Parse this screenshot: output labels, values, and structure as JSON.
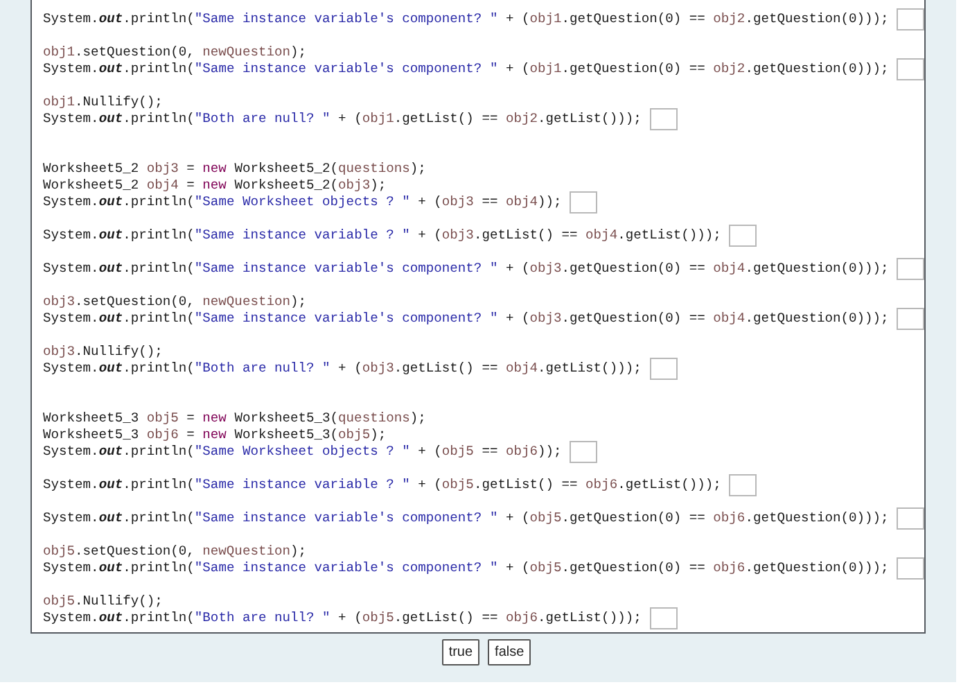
{
  "sections": [
    {
      "blocks": [
        {
          "lines": [
            {
              "has_answer": true,
              "parts": [
                {
                  "kind": "plain",
                  "text": "System."
                },
                {
                  "kind": "field",
                  "text": "out"
                },
                {
                  "kind": "plain",
                  "text": ".println("
                },
                {
                  "kind": "string",
                  "text": "\"Same instance variable's component? \""
                },
                {
                  "kind": "plain",
                  "text": " + ("
                },
                {
                  "kind": "var",
                  "text": "obj1"
                },
                {
                  "kind": "plain",
                  "text": ".getQuestion(0) == "
                },
                {
                  "kind": "var",
                  "text": "obj2"
                },
                {
                  "kind": "plain",
                  "text": ".getQuestion(0)));"
                }
              ]
            }
          ]
        },
        {
          "lines": [
            {
              "has_answer": false,
              "parts": [
                {
                  "kind": "var",
                  "text": "obj1"
                },
                {
                  "kind": "plain",
                  "text": ".setQuestion(0, "
                },
                {
                  "kind": "var",
                  "text": "newQuestion"
                },
                {
                  "kind": "plain",
                  "text": ");"
                }
              ]
            },
            {
              "has_answer": true,
              "parts": [
                {
                  "kind": "plain",
                  "text": "System."
                },
                {
                  "kind": "field",
                  "text": "out"
                },
                {
                  "kind": "plain",
                  "text": ".println("
                },
                {
                  "kind": "string",
                  "text": "\"Same instance variable's component? \""
                },
                {
                  "kind": "plain",
                  "text": " + ("
                },
                {
                  "kind": "var",
                  "text": "obj1"
                },
                {
                  "kind": "plain",
                  "text": ".getQuestion(0) == "
                },
                {
                  "kind": "var",
                  "text": "obj2"
                },
                {
                  "kind": "plain",
                  "text": ".getQuestion(0)));"
                }
              ]
            }
          ]
        },
        {
          "lines": [
            {
              "has_answer": false,
              "parts": [
                {
                  "kind": "var",
                  "text": "obj1"
                },
                {
                  "kind": "plain",
                  "text": ".Nullify();"
                }
              ]
            },
            {
              "has_answer": true,
              "parts": [
                {
                  "kind": "plain",
                  "text": "System."
                },
                {
                  "kind": "field",
                  "text": "out"
                },
                {
                  "kind": "plain",
                  "text": ".println("
                },
                {
                  "kind": "string",
                  "text": "\"Both are null? \""
                },
                {
                  "kind": "plain",
                  "text": " + ("
                },
                {
                  "kind": "var",
                  "text": "obj1"
                },
                {
                  "kind": "plain",
                  "text": ".getList() == "
                },
                {
                  "kind": "var",
                  "text": "obj2"
                },
                {
                  "kind": "plain",
                  "text": ".getList()));"
                }
              ]
            }
          ]
        }
      ]
    },
    {
      "blocks": [
        {
          "lines": [
            {
              "has_answer": false,
              "parts": [
                {
                  "kind": "plain",
                  "text": "Worksheet5_2 "
                },
                {
                  "kind": "var",
                  "text": "obj3"
                },
                {
                  "kind": "plain",
                  "text": " = "
                },
                {
                  "kind": "keyword",
                  "text": "new"
                },
                {
                  "kind": "plain",
                  "text": " Worksheet5_2("
                },
                {
                  "kind": "var",
                  "text": "questions"
                },
                {
                  "kind": "plain",
                  "text": ");"
                }
              ]
            },
            {
              "has_answer": false,
              "parts": [
                {
                  "kind": "plain",
                  "text": "Worksheet5_2 "
                },
                {
                  "kind": "var",
                  "text": "obj4"
                },
                {
                  "kind": "plain",
                  "text": " = "
                },
                {
                  "kind": "keyword",
                  "text": "new"
                },
                {
                  "kind": "plain",
                  "text": " Worksheet5_2("
                },
                {
                  "kind": "var",
                  "text": "obj3"
                },
                {
                  "kind": "plain",
                  "text": ");"
                }
              ]
            },
            {
              "has_answer": true,
              "parts": [
                {
                  "kind": "plain",
                  "text": "System."
                },
                {
                  "kind": "field",
                  "text": "out"
                },
                {
                  "kind": "plain",
                  "text": ".println("
                },
                {
                  "kind": "string",
                  "text": "\"Same Worksheet objects ? \""
                },
                {
                  "kind": "plain",
                  "text": " + ("
                },
                {
                  "kind": "var",
                  "text": "obj3"
                },
                {
                  "kind": "plain",
                  "text": " == "
                },
                {
                  "kind": "var",
                  "text": "obj4"
                },
                {
                  "kind": "plain",
                  "text": "));"
                }
              ]
            }
          ]
        },
        {
          "lines": [
            {
              "has_answer": true,
              "parts": [
                {
                  "kind": "plain",
                  "text": "System."
                },
                {
                  "kind": "field",
                  "text": "out"
                },
                {
                  "kind": "plain",
                  "text": ".println("
                },
                {
                  "kind": "string",
                  "text": "\"Same instance variable ? \""
                },
                {
                  "kind": "plain",
                  "text": " + ("
                },
                {
                  "kind": "var",
                  "text": "obj3"
                },
                {
                  "kind": "plain",
                  "text": ".getList() == "
                },
                {
                  "kind": "var",
                  "text": "obj4"
                },
                {
                  "kind": "plain",
                  "text": ".getList()));"
                }
              ]
            }
          ]
        },
        {
          "lines": [
            {
              "has_answer": true,
              "parts": [
                {
                  "kind": "plain",
                  "text": "System."
                },
                {
                  "kind": "field",
                  "text": "out"
                },
                {
                  "kind": "plain",
                  "text": ".println("
                },
                {
                  "kind": "string",
                  "text": "\"Same instance variable's component? \""
                },
                {
                  "kind": "plain",
                  "text": " + ("
                },
                {
                  "kind": "var",
                  "text": "obj3"
                },
                {
                  "kind": "plain",
                  "text": ".getQuestion(0) == "
                },
                {
                  "kind": "var",
                  "text": "obj4"
                },
                {
                  "kind": "plain",
                  "text": ".getQuestion(0)));"
                }
              ]
            }
          ]
        },
        {
          "lines": [
            {
              "has_answer": false,
              "parts": [
                {
                  "kind": "var",
                  "text": "obj3"
                },
                {
                  "kind": "plain",
                  "text": ".setQuestion(0, "
                },
                {
                  "kind": "var",
                  "text": "newQuestion"
                },
                {
                  "kind": "plain",
                  "text": ");"
                }
              ]
            },
            {
              "has_answer": true,
              "parts": [
                {
                  "kind": "plain",
                  "text": "System."
                },
                {
                  "kind": "field",
                  "text": "out"
                },
                {
                  "kind": "plain",
                  "text": ".println("
                },
                {
                  "kind": "string",
                  "text": "\"Same instance variable's component? \""
                },
                {
                  "kind": "plain",
                  "text": " + ("
                },
                {
                  "kind": "var",
                  "text": "obj3"
                },
                {
                  "kind": "plain",
                  "text": ".getQuestion(0) == "
                },
                {
                  "kind": "var",
                  "text": "obj4"
                },
                {
                  "kind": "plain",
                  "text": ".getQuestion(0)));"
                }
              ]
            }
          ]
        },
        {
          "lines": [
            {
              "has_answer": false,
              "parts": [
                {
                  "kind": "var",
                  "text": "obj3"
                },
                {
                  "kind": "plain",
                  "text": ".Nullify();"
                }
              ]
            },
            {
              "has_answer": true,
              "parts": [
                {
                  "kind": "plain",
                  "text": "System."
                },
                {
                  "kind": "field",
                  "text": "out"
                },
                {
                  "kind": "plain",
                  "text": ".println("
                },
                {
                  "kind": "string",
                  "text": "\"Both are null? \""
                },
                {
                  "kind": "plain",
                  "text": " + ("
                },
                {
                  "kind": "var",
                  "text": "obj3"
                },
                {
                  "kind": "plain",
                  "text": ".getList() == "
                },
                {
                  "kind": "var",
                  "text": "obj4"
                },
                {
                  "kind": "plain",
                  "text": ".getList()));"
                }
              ]
            }
          ]
        }
      ]
    },
    {
      "blocks": [
        {
          "lines": [
            {
              "has_answer": false,
              "parts": [
                {
                  "kind": "plain",
                  "text": "Worksheet5_3 "
                },
                {
                  "kind": "var",
                  "text": "obj5"
                },
                {
                  "kind": "plain",
                  "text": " = "
                },
                {
                  "kind": "keyword",
                  "text": "new"
                },
                {
                  "kind": "plain",
                  "text": " Worksheet5_3("
                },
                {
                  "kind": "var",
                  "text": "questions"
                },
                {
                  "kind": "plain",
                  "text": ");"
                }
              ]
            },
            {
              "has_answer": false,
              "parts": [
                {
                  "kind": "plain",
                  "text": "Worksheet5_3 "
                },
                {
                  "kind": "var",
                  "text": "obj6"
                },
                {
                  "kind": "plain",
                  "text": " = "
                },
                {
                  "kind": "keyword",
                  "text": "new"
                },
                {
                  "kind": "plain",
                  "text": " Worksheet5_3("
                },
                {
                  "kind": "var",
                  "text": "obj5"
                },
                {
                  "kind": "plain",
                  "text": ");"
                }
              ]
            },
            {
              "has_answer": true,
              "parts": [
                {
                  "kind": "plain",
                  "text": "System."
                },
                {
                  "kind": "field",
                  "text": "out"
                },
                {
                  "kind": "plain",
                  "text": ".println("
                },
                {
                  "kind": "string",
                  "text": "\"Same Worksheet objects ? \""
                },
                {
                  "kind": "plain",
                  "text": " + ("
                },
                {
                  "kind": "var",
                  "text": "obj5"
                },
                {
                  "kind": "plain",
                  "text": " == "
                },
                {
                  "kind": "var",
                  "text": "obj6"
                },
                {
                  "kind": "plain",
                  "text": "));"
                }
              ]
            }
          ]
        },
        {
          "lines": [
            {
              "has_answer": true,
              "parts": [
                {
                  "kind": "plain",
                  "text": "System."
                },
                {
                  "kind": "field",
                  "text": "out"
                },
                {
                  "kind": "plain",
                  "text": ".println("
                },
                {
                  "kind": "string",
                  "text": "\"Same instance variable ? \""
                },
                {
                  "kind": "plain",
                  "text": " + ("
                },
                {
                  "kind": "var",
                  "text": "obj5"
                },
                {
                  "kind": "plain",
                  "text": ".getList() == "
                },
                {
                  "kind": "var",
                  "text": "obj6"
                },
                {
                  "kind": "plain",
                  "text": ".getList()));"
                }
              ]
            }
          ]
        },
        {
          "lines": [
            {
              "has_answer": true,
              "parts": [
                {
                  "kind": "plain",
                  "text": "System."
                },
                {
                  "kind": "field",
                  "text": "out"
                },
                {
                  "kind": "plain",
                  "text": ".println("
                },
                {
                  "kind": "string",
                  "text": "\"Same instance variable's component? \""
                },
                {
                  "kind": "plain",
                  "text": " + ("
                },
                {
                  "kind": "var",
                  "text": "obj5"
                },
                {
                  "kind": "plain",
                  "text": ".getQuestion(0) == "
                },
                {
                  "kind": "var",
                  "text": "obj6"
                },
                {
                  "kind": "plain",
                  "text": ".getQuestion(0)));"
                }
              ]
            }
          ]
        },
        {
          "lines": [
            {
              "has_answer": false,
              "parts": [
                {
                  "kind": "var",
                  "text": "obj5"
                },
                {
                  "kind": "plain",
                  "text": ".setQuestion(0, "
                },
                {
                  "kind": "var",
                  "text": "newQuestion"
                },
                {
                  "kind": "plain",
                  "text": ");"
                }
              ]
            },
            {
              "has_answer": true,
              "parts": [
                {
                  "kind": "plain",
                  "text": "System."
                },
                {
                  "kind": "field",
                  "text": "out"
                },
                {
                  "kind": "plain",
                  "text": ".println("
                },
                {
                  "kind": "string",
                  "text": "\"Same instance variable's component? \""
                },
                {
                  "kind": "plain",
                  "text": " + ("
                },
                {
                  "kind": "var",
                  "text": "obj5"
                },
                {
                  "kind": "plain",
                  "text": ".getQuestion(0) == "
                },
                {
                  "kind": "var",
                  "text": "obj6"
                },
                {
                  "kind": "plain",
                  "text": ".getQuestion(0)));"
                }
              ]
            }
          ]
        },
        {
          "lines": [
            {
              "has_answer": false,
              "parts": [
                {
                  "kind": "var",
                  "text": "obj5"
                },
                {
                  "kind": "plain",
                  "text": ".Nullify();"
                }
              ]
            },
            {
              "has_answer": true,
              "parts": [
                {
                  "kind": "plain",
                  "text": "System."
                },
                {
                  "kind": "field",
                  "text": "out"
                },
                {
                  "kind": "plain",
                  "text": ".println("
                },
                {
                  "kind": "string",
                  "text": "\"Both are null? \""
                },
                {
                  "kind": "plain",
                  "text": " + ("
                },
                {
                  "kind": "var",
                  "text": "obj5"
                },
                {
                  "kind": "plain",
                  "text": ".getList() == "
                },
                {
                  "kind": "var",
                  "text": "obj6"
                },
                {
                  "kind": "plain",
                  "text": ".getList()));"
                }
              ]
            }
          ]
        }
      ]
    }
  ],
  "buttons": [
    "true",
    "false"
  ]
}
